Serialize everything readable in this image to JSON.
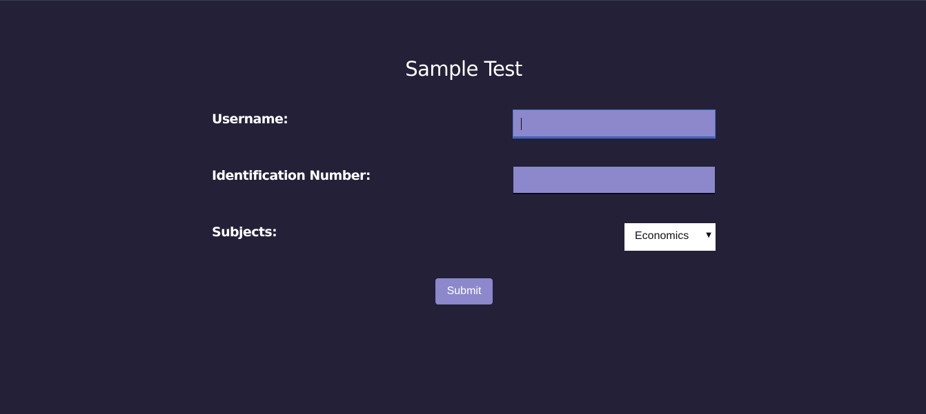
{
  "form": {
    "title": "Sample Test",
    "username": {
      "label": "Username:",
      "value": ""
    },
    "identification_number": {
      "label": "Identification Number:",
      "value": ""
    },
    "subjects": {
      "label": "Subjects:",
      "selected": "Economics"
    },
    "submit_label": "Submit"
  },
  "colors": {
    "background": "#232037",
    "field_fill": "#8c88cb",
    "focus_outline": "#4a78d8",
    "text": "#ffffff"
  },
  "icons": {
    "dropdown": "caret-down-icon"
  }
}
